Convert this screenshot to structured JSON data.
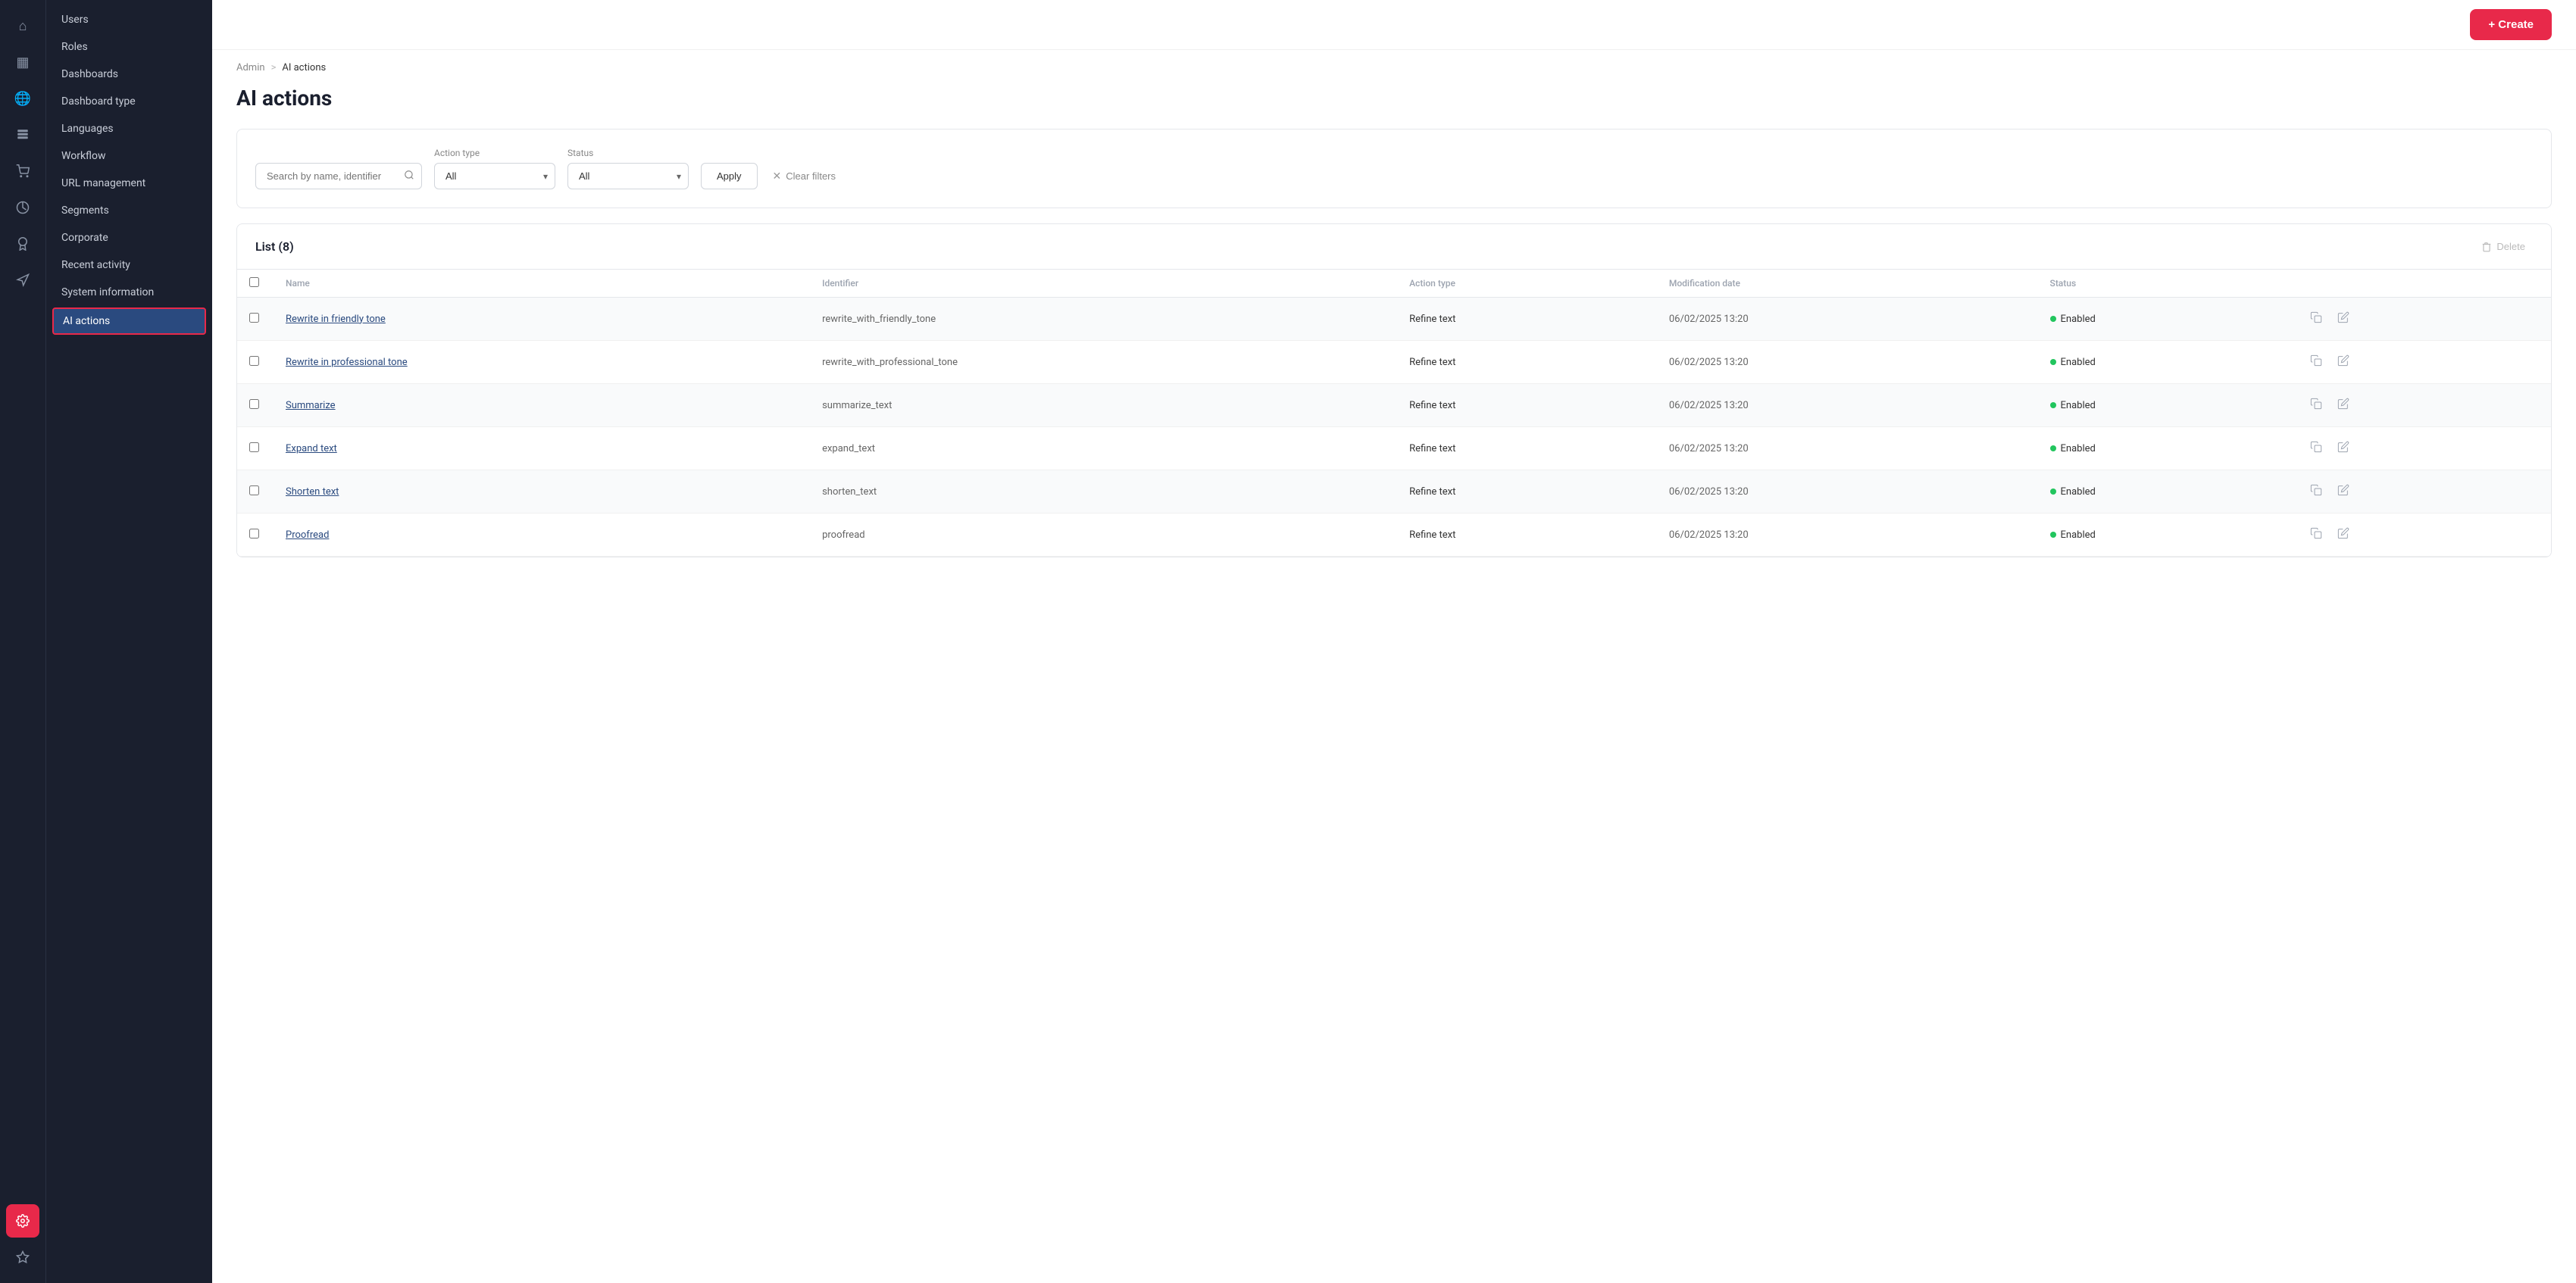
{
  "brand": {
    "colors": {
      "accent": "#e8294a",
      "sidebar_bg": "#1a1f2e",
      "active_nav": "#2a4a7f"
    }
  },
  "breadcrumb": {
    "parent": "Admin",
    "separator": ">",
    "current": "AI actions"
  },
  "page": {
    "title": "AI actions"
  },
  "topbar": {
    "create_label": "+ Create"
  },
  "filters": {
    "search_placeholder": "Search by name, identifier",
    "action_type_label": "Action type",
    "action_type_value": "All",
    "status_label": "Status",
    "status_value": "All",
    "apply_label": "Apply",
    "clear_filters_label": "Clear filters"
  },
  "table": {
    "title": "List (8)",
    "delete_label": "Delete",
    "columns": {
      "name": "Name",
      "identifier": "Identifier",
      "action_type": "Action type",
      "modification_date": "Modification date",
      "status": "Status"
    },
    "rows": [
      {
        "name": "Rewrite in friendly tone",
        "identifier": "rewrite_with_friendly_tone",
        "action_type": "Refine text",
        "modification_date": "06/02/2025 13:20",
        "status": "Enabled"
      },
      {
        "name": "Rewrite in professional tone",
        "identifier": "rewrite_with_professional_tone",
        "action_type": "Refine text",
        "modification_date": "06/02/2025 13:20",
        "status": "Enabled"
      },
      {
        "name": "Summarize",
        "identifier": "summarize_text",
        "action_type": "Refine text",
        "modification_date": "06/02/2025 13:20",
        "status": "Enabled"
      },
      {
        "name": "Expand text",
        "identifier": "expand_text",
        "action_type": "Refine text",
        "modification_date": "06/02/2025 13:20",
        "status": "Enabled"
      },
      {
        "name": "Shorten text",
        "identifier": "shorten_text",
        "action_type": "Refine text",
        "modification_date": "06/02/2025 13:20",
        "status": "Enabled"
      },
      {
        "name": "Proofread",
        "identifier": "proofread",
        "action_type": "Refine text",
        "modification_date": "06/02/2025 13:20",
        "status": "Enabled"
      }
    ]
  },
  "icon_sidebar": {
    "items": [
      {
        "name": "home",
        "icon": "⌂",
        "active": false
      },
      {
        "name": "grid",
        "icon": "▦",
        "active": false
      },
      {
        "name": "globe",
        "icon": "◉",
        "active": false
      },
      {
        "name": "contacts",
        "icon": "👤",
        "active": false
      },
      {
        "name": "cart",
        "icon": "🛒",
        "active": false
      },
      {
        "name": "analytics",
        "icon": "◎",
        "active": false
      },
      {
        "name": "badge",
        "icon": "⊕",
        "active": false
      },
      {
        "name": "megaphone",
        "icon": "📣",
        "active": false
      }
    ],
    "bottom_items": [
      {
        "name": "settings",
        "icon": "⚙",
        "active": true
      },
      {
        "name": "star",
        "icon": "☆",
        "active": false
      }
    ]
  },
  "nav_sidebar": {
    "items": [
      {
        "label": "Users",
        "active": false
      },
      {
        "label": "Roles",
        "active": false
      },
      {
        "label": "Dashboards",
        "active": false
      },
      {
        "label": "Dashboard type",
        "active": false
      },
      {
        "label": "Languages",
        "active": false
      },
      {
        "label": "Workflow",
        "active": false
      },
      {
        "label": "URL management",
        "active": false
      },
      {
        "label": "Segments",
        "active": false
      },
      {
        "label": "Corporate",
        "active": false
      },
      {
        "label": "Recent activity",
        "active": false
      },
      {
        "label": "System information",
        "active": false
      },
      {
        "label": "AI actions",
        "active": true
      }
    ]
  }
}
